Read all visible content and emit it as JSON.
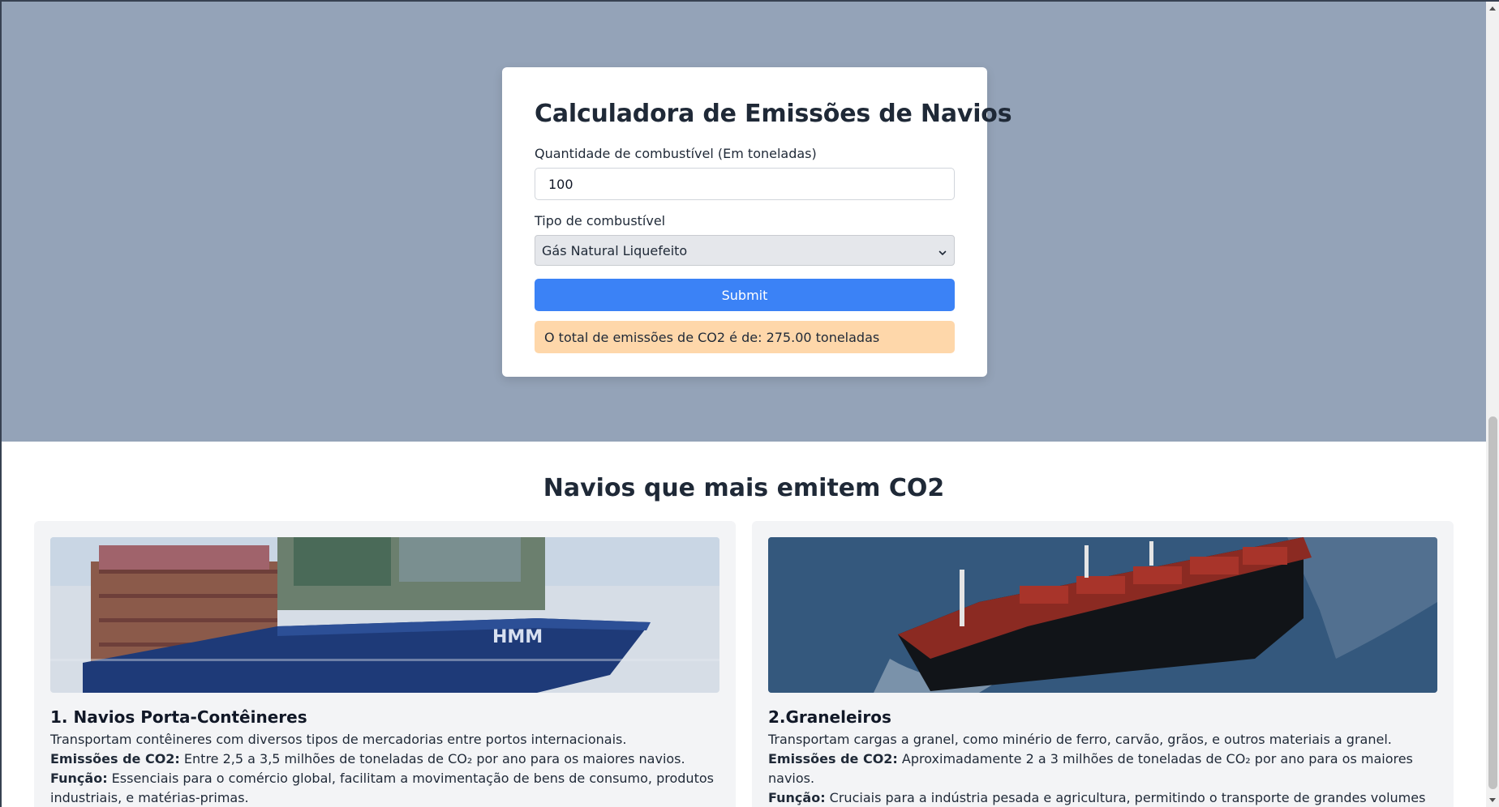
{
  "calculator": {
    "title": "Calculadora de Emissões de Navios",
    "fuel_amount_label": "Quantidade de combustível (Em toneladas)",
    "fuel_amount_value": "100",
    "fuel_type_label": "Tipo de combustível",
    "fuel_type_selected": "Gás Natural Liquefeito",
    "submit_label": "Submit",
    "result_text": "O total de emissões de CO2 é de: 275.00 toneladas"
  },
  "ships_section": {
    "title": "Navios que mais emitem CO2",
    "cards": [
      {
        "name": "1. Navios Porta-Contêineres",
        "description": "Transportam contêineres com diversos tipos de mercadorias entre portos internacionais.",
        "emissions_label": "Emissões de CO2:",
        "emissions_text": " Entre 2,5 a 3,5 milhões de toneladas de CO₂ por ano para os maiores navios.",
        "function_label": "Função:",
        "function_text": " Essenciais para o comércio global, facilitam a movimentação de bens de consumo, produtos industriais, e matérias-primas.",
        "image_name": "container-ship-photo"
      },
      {
        "name": "2.Graneleiros",
        "description": "Transportam cargas a granel, como minério de ferro, carvão, grãos, e outros materiais a granel.",
        "emissions_label": "Emissões de CO2:",
        "emissions_text": " Aproximadamente 2 a 3 milhões de toneladas de CO₂ por ano para os maiores navios.",
        "function_label": "Função:",
        "function_text": " Cruciais para a indústria pesada e agricultura, permitindo o transporte de grandes volumes de commodities.",
        "image_name": "bulk-carrier-photo"
      }
    ]
  },
  "colors": {
    "hero_bg": "#94a3b8",
    "submit_bg": "#3b82f6",
    "result_bg": "#fed7aa",
    "card_bg": "#f3f4f6"
  }
}
